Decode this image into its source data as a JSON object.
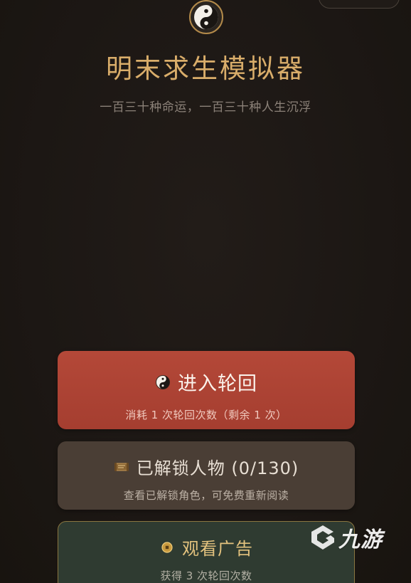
{
  "app": {
    "title": "明末求生模拟器",
    "subtitle": "一百三十种命运，一百三十种人生沉浮",
    "logo_icon": "taiji-icon"
  },
  "buttons": {
    "enter": {
      "icon": "taiji-icon",
      "label": "进入轮回",
      "sub": "消耗 1 次轮回次数（剩余 1 次）"
    },
    "unlocked": {
      "icon": "scroll-icon",
      "label": "已解锁人物 (0/130)",
      "sub": "查看已解锁角色，可免费重新阅读"
    },
    "ad": {
      "icon": "coin-icon",
      "label": "观看广告",
      "sub": "获得 3 次轮回次数"
    }
  },
  "watermark": {
    "text": "九游"
  },
  "colors": {
    "background": "#1d1814",
    "gold": "#d9ad6a",
    "primary_button": "#b44838",
    "secondary_button": "#4a3e35",
    "ad_button": "#2f3b31",
    "ad_border": "#8a7640"
  }
}
